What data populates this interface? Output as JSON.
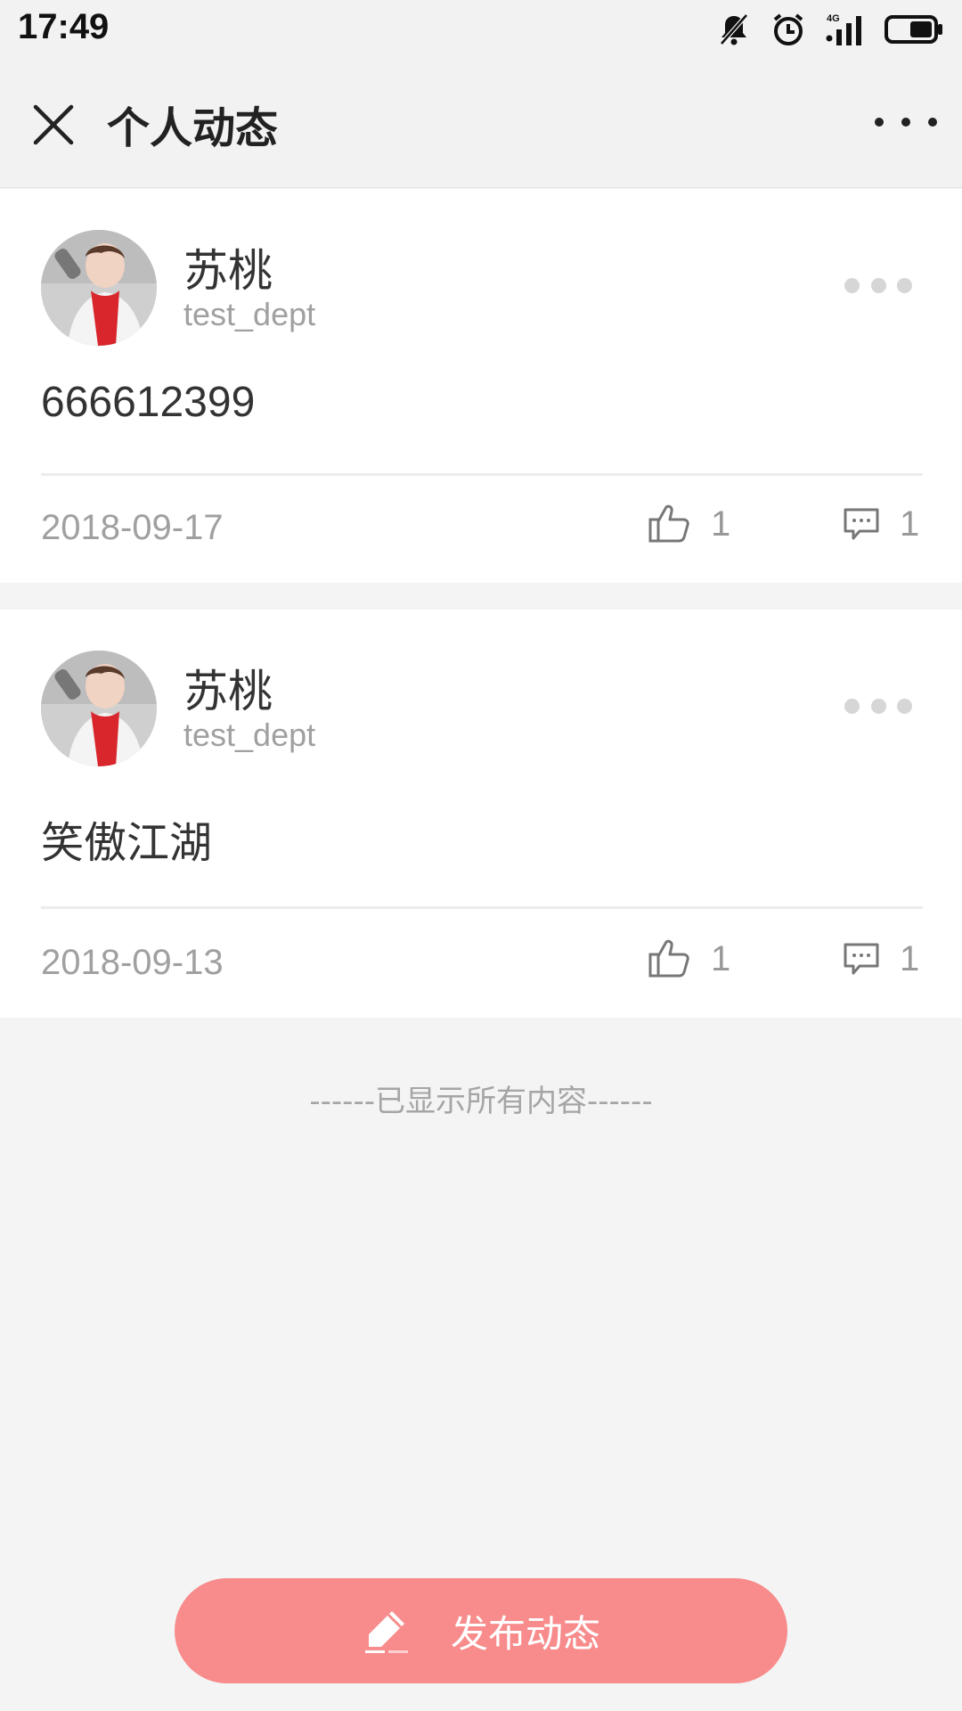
{
  "status_bar": {
    "time": "17:49",
    "network": "4G",
    "icons": [
      "mute-bell-icon",
      "alarm-icon",
      "signal-icon",
      "battery-icon"
    ]
  },
  "header": {
    "title": "个人动态",
    "close_icon": "close-icon",
    "more_icon": "more-icon"
  },
  "posts": [
    {
      "user_name": "苏桃",
      "dept": "test_dept",
      "content": "666612399",
      "date": "2018-09-17",
      "likes": "1",
      "comments": "1"
    },
    {
      "user_name": "苏桃",
      "dept": "test_dept",
      "content": "笑傲江湖",
      "date": "2018-09-13",
      "likes": "1",
      "comments": "1"
    }
  ],
  "end_note": "------已显示所有内容------",
  "publish_button": {
    "label": "发布动态",
    "icon": "pencil-icon"
  },
  "colors": {
    "accent": "#f88b8b",
    "background": "#f4f4f4",
    "card": "#ffffff",
    "muted_text": "#a0a0a0"
  }
}
